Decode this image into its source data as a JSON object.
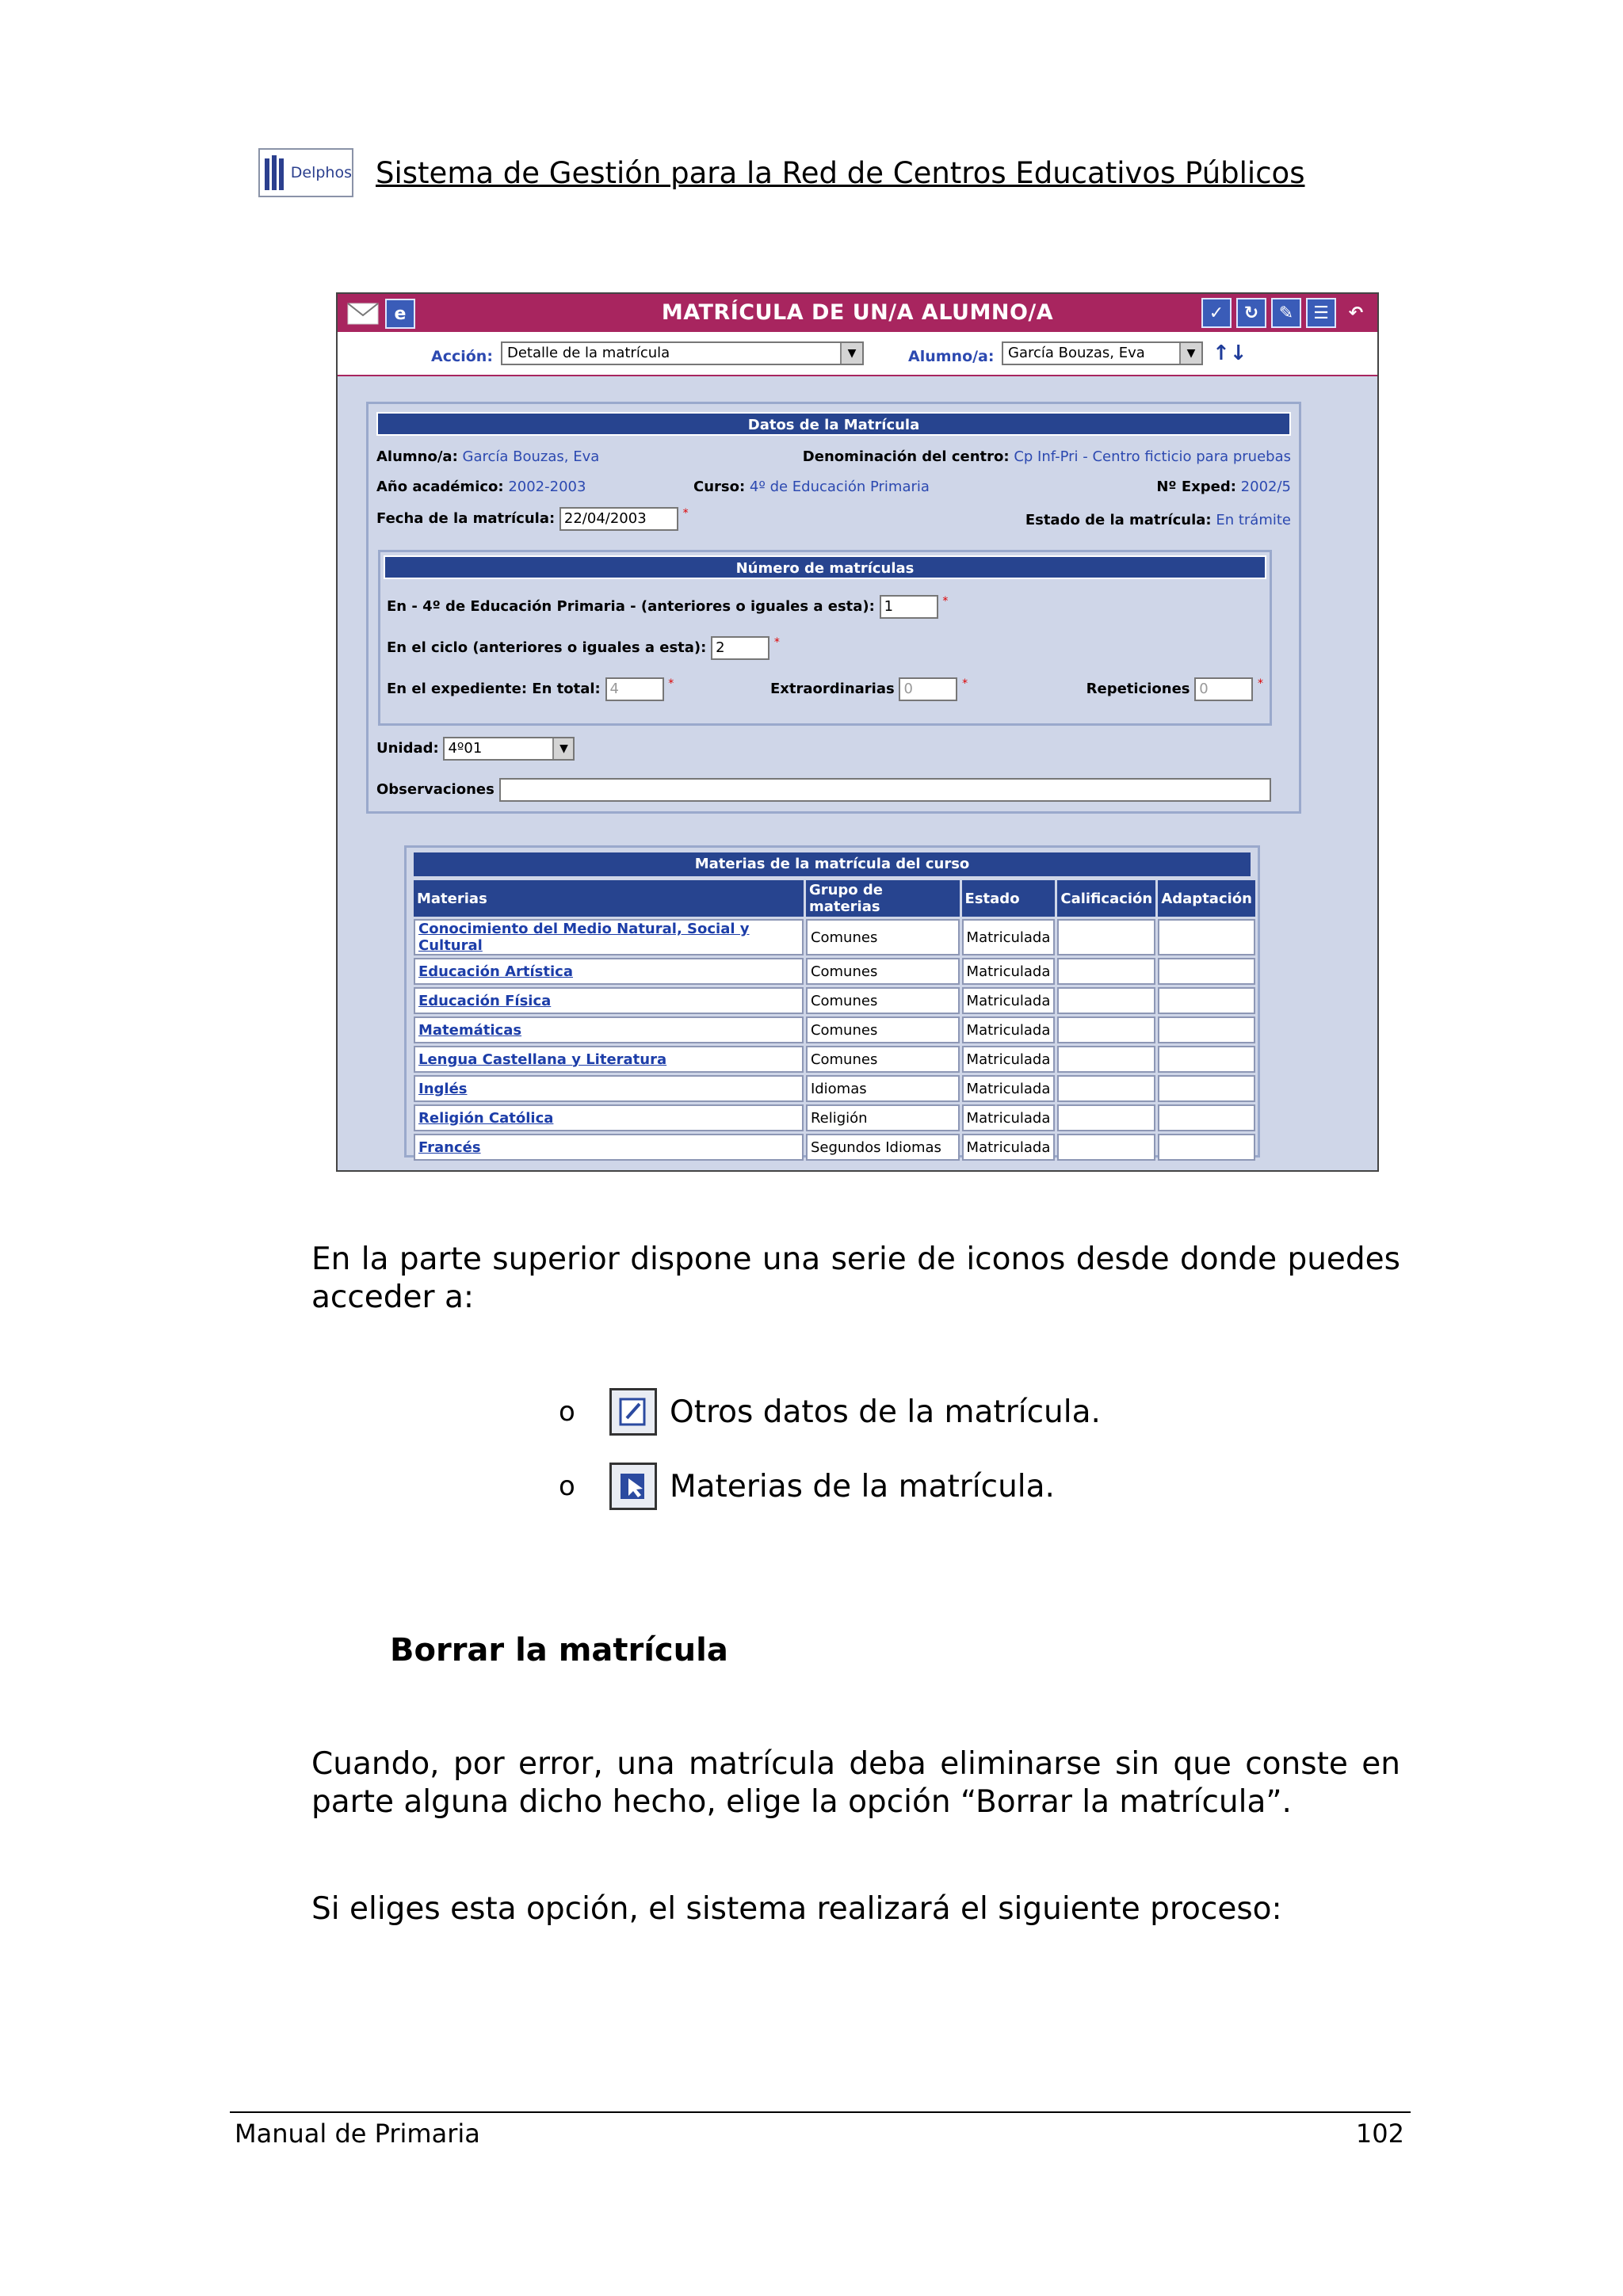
{
  "header": {
    "logo_text": "Delphos",
    "title": "Sistema de Gestión para la Red de Centros Educativos Públicos"
  },
  "app": {
    "title": "MATRÍCULA DE UN/A ALUMNO/A",
    "toolbar": {
      "accion_label": "Acción:",
      "accion_value": "Detalle de la matrícula",
      "alumno_label": "Alumno/a:",
      "alumno_value": "García Bouzas, Eva"
    },
    "datos": {
      "header": "Datos de la Matrícula",
      "alumno_label": "Alumno/a:",
      "alumno_value": "García Bouzas, Eva",
      "centro_label": "Denominación del centro:",
      "centro_value": "Cp Inf-Pri - Centro ficticio para pruebas",
      "anio_label": "Año académico:",
      "anio_value": "2002-2003",
      "curso_label": "Curso:",
      "curso_value": "4º de Educación Primaria",
      "exped_label": "Nº Exped:",
      "exped_value": "2002/5",
      "fecha_label": "Fecha de la matrícula:",
      "fecha_value": "22/04/2003",
      "estado_label": "Estado de la matrícula:",
      "estado_value": "En trámite",
      "required_mark": "*"
    },
    "numero": {
      "header": "Número de matrículas",
      "en_curso_label": "En - 4º de Educación Primaria - (anteriores o iguales a esta):",
      "en_curso_value": "1",
      "en_ciclo_label": "En el ciclo (anteriores o iguales a esta):",
      "en_ciclo_value": "2",
      "expediente_label": "En el expediente: En total:",
      "expediente_value": "4",
      "extra_label": "Extraordinarias",
      "extra_value": "0",
      "repeticiones_label": "Repeticiones",
      "repeticiones_value": "0"
    },
    "unidad_label": "Unidad:",
    "unidad_value": "4º01",
    "observaciones_label": "Observaciones",
    "materias": {
      "title": "Materias de la matrícula del curso",
      "columns": [
        "Materias",
        "Grupo de materias",
        "Estado",
        "Calificación",
        "Adaptación"
      ],
      "rows": [
        {
          "materia": "Conocimiento del Medio Natural, Social y Cultural",
          "grupo": "Comunes",
          "estado": "Matriculada"
        },
        {
          "materia": "Educación Artística",
          "grupo": "Comunes",
          "estado": "Matriculada"
        },
        {
          "materia": "Educación Física",
          "grupo": "Comunes",
          "estado": "Matriculada"
        },
        {
          "materia": "Matemáticas",
          "grupo": "Comunes",
          "estado": "Matriculada"
        },
        {
          "materia": "Lengua Castellana y Literatura",
          "grupo": "Comunes",
          "estado": "Matriculada"
        },
        {
          "materia": "Inglés",
          "grupo": "Idiomas",
          "estado": "Matriculada"
        },
        {
          "materia": "Religión Católica",
          "grupo": "Religión",
          "estado": "Matriculada"
        },
        {
          "materia": "Francés",
          "grupo": "Segundos Idiomas",
          "estado": "Matriculada"
        }
      ]
    }
  },
  "body": {
    "intro": "En la parte superior dispone una serie de iconos desde donde puedes acceder a:",
    "bullets": [
      "Otros datos de la matrícula.",
      "Materias de la matrícula."
    ],
    "bullet_marker": "o",
    "heading": "Borrar la matrícula",
    "para1": "Cuando, por error, una matrícula deba eliminarse sin que conste en parte alguna dicho hecho, elige la opción “Borrar la matrícula”.",
    "para2": "Si eliges esta opción, el sistema realizará el siguiente proceso:"
  },
  "footer": {
    "left": "Manual de Primaria",
    "right": "102"
  },
  "colors": {
    "app_titlebar": "#a8255f",
    "panel_header": "#27448f",
    "link": "#1c3da8"
  }
}
